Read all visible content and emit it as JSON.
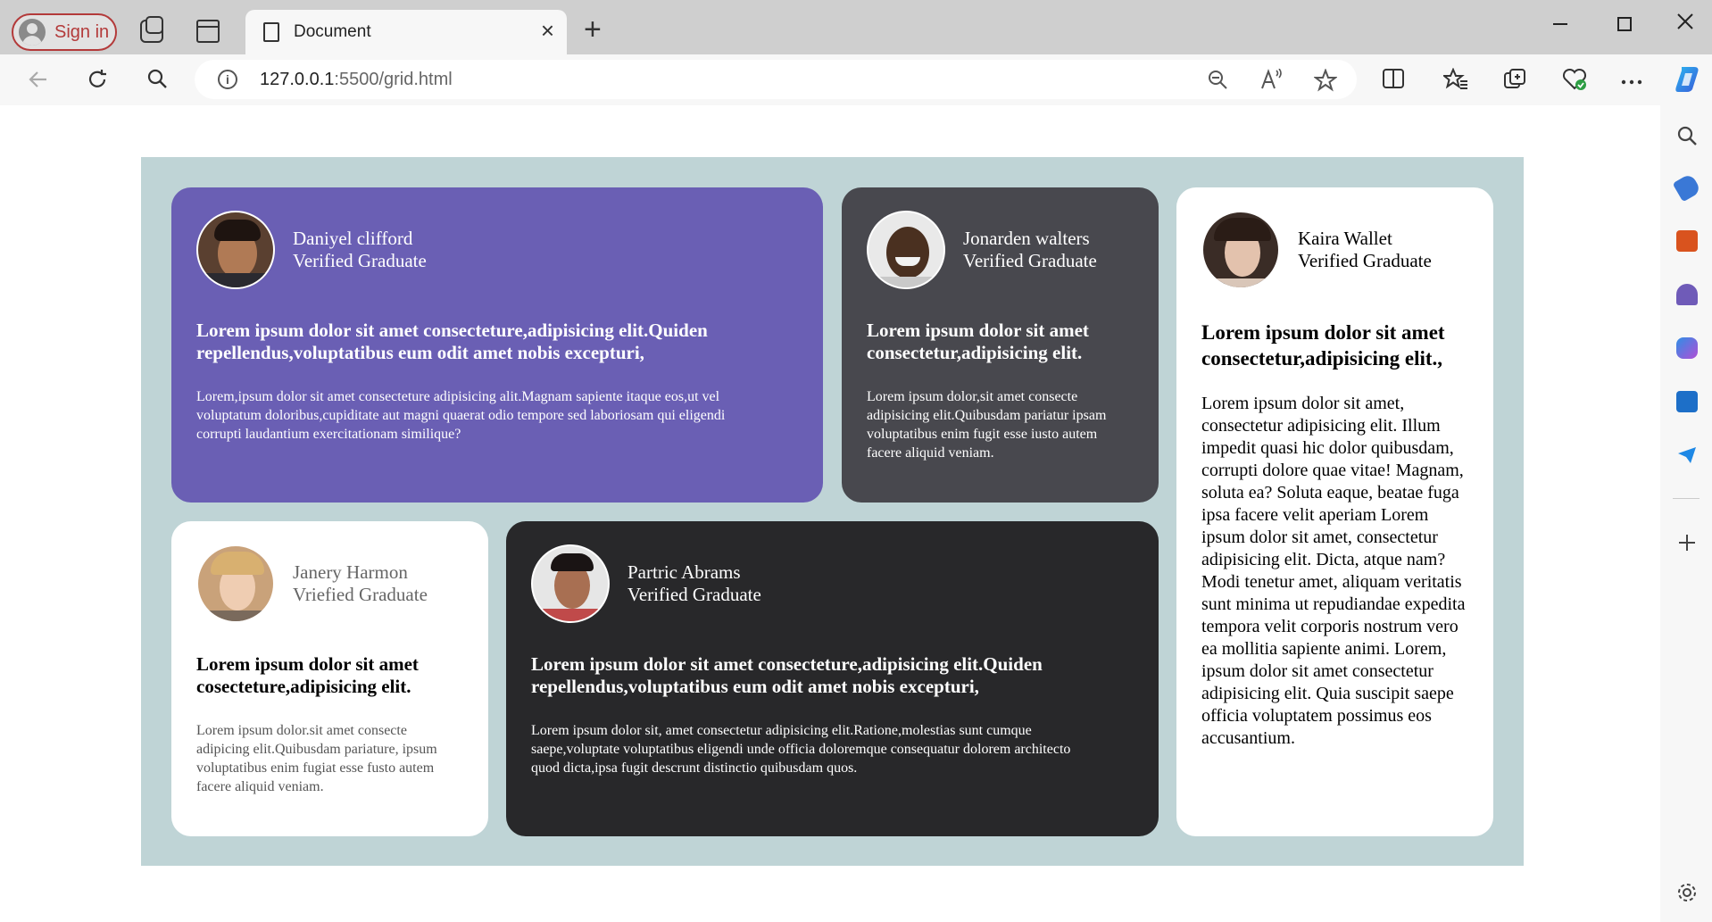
{
  "browser": {
    "sign_in_label": "Sign in",
    "tab_title": "Document",
    "url_host": "127.0.0.1",
    "url_rest": ":5500/grid.html",
    "close_tab_glyph": "×",
    "new_tab_glyph": "+"
  },
  "cards": [
    {
      "name": "Daniyel clifford",
      "badge": "Verified Graduate",
      "heading": "Lorem ipsum dolor sit amet consecteture,adipisicing elit.Quiden repellendus,voluptatibus eum odit amet nobis excepturi,",
      "body": "Lorem,ipsum dolor sit amet consecteture adipisicing alit.Magnam sapiente itaque eos,ut vel voluptatum doloribus,cupiditate aut magni quaerat odio tempore sed laboriosam qui eligendi corrupti laudantium exercitationam similique?",
      "bg": "#6a5fb4"
    },
    {
      "name": "Jonarden walters",
      "badge": "Verified Graduate",
      "heading": "Lorem ipsum dolor sit amet consectetur,adipisicing elit.",
      "body": "Lorem ipsum dolor,sit amet consecte adipisicing elit.Quibusdam pariatur ipsam voluptatibus enim fugit esse iusto autem facere aliquid veniam.",
      "bg": "#48484e"
    },
    {
      "name": "Kaira Wallet",
      "badge": "Verified Graduate",
      "heading": "Lorem ipsum dolor sit amet consectetur,adipisicing elit.,",
      "body": "Lorem ipsum dolor sit amet, consectetur adipisicing elit. Illum impedit quasi hic dolor quibusdam, corrupti dolore quae vitae! Magnam, soluta ea? Soluta eaque, beatae fuga ipsa facere velit aperiam Lorem ipsum dolor sit amet, consectetur adipisicing elit. Dicta, atque nam? Modi tenetur amet, aliquam veritatis sunt minima ut repudiandae expedita tempora velit corporis nostrum vero ea mollitia sapiente animi. Lorem, ipsum dolor sit amet consectetur adipisicing elit. Quia suscipit saepe officia voluptatem possimus eos accusantium.",
      "bg": "#ffffff"
    },
    {
      "name": "Janery Harmon",
      "badge": "Vriefied Graduate",
      "heading": "Lorem ipsum dolor sit amet cosecteture,adipisicing elit.",
      "body": "Lorem ipsum dolor.sit amet consecte adipicing elit.Quibusdam pariature, ipsum voluptatibus enim fugiat esse fusto autem facere aliquid veniam.",
      "bg": "#ffffff"
    },
    {
      "name": "Partric Abrams",
      "badge": "Verified Graduate",
      "heading": "Lorem ipsum dolor sit amet consecteture,adipisicing elit.Quiden repellendus,voluptatibus eum odit amet nobis excepturi,",
      "body": "Lorem ipsum dolor sit, amet consectetur adipisicing elit.Ratione,molestias sunt cumque saepe,voluptate voluptatibus eligendi unde officia doloremque consequatur dolorem architecto quod dicta,ipsa fugit descrunt distinctio quibusdam quos.",
      "bg": "#28282a"
    }
  ],
  "colors": {
    "grid_bg": "#bfd4d6",
    "accent_signin": "#b33a3a"
  },
  "icons": {
    "sidebar": [
      "search-icon",
      "tag-icon",
      "toolbox-icon",
      "games-icon",
      "m365-icon",
      "outlook-icon",
      "send-icon",
      "plus-icon",
      "settings-icon"
    ]
  }
}
